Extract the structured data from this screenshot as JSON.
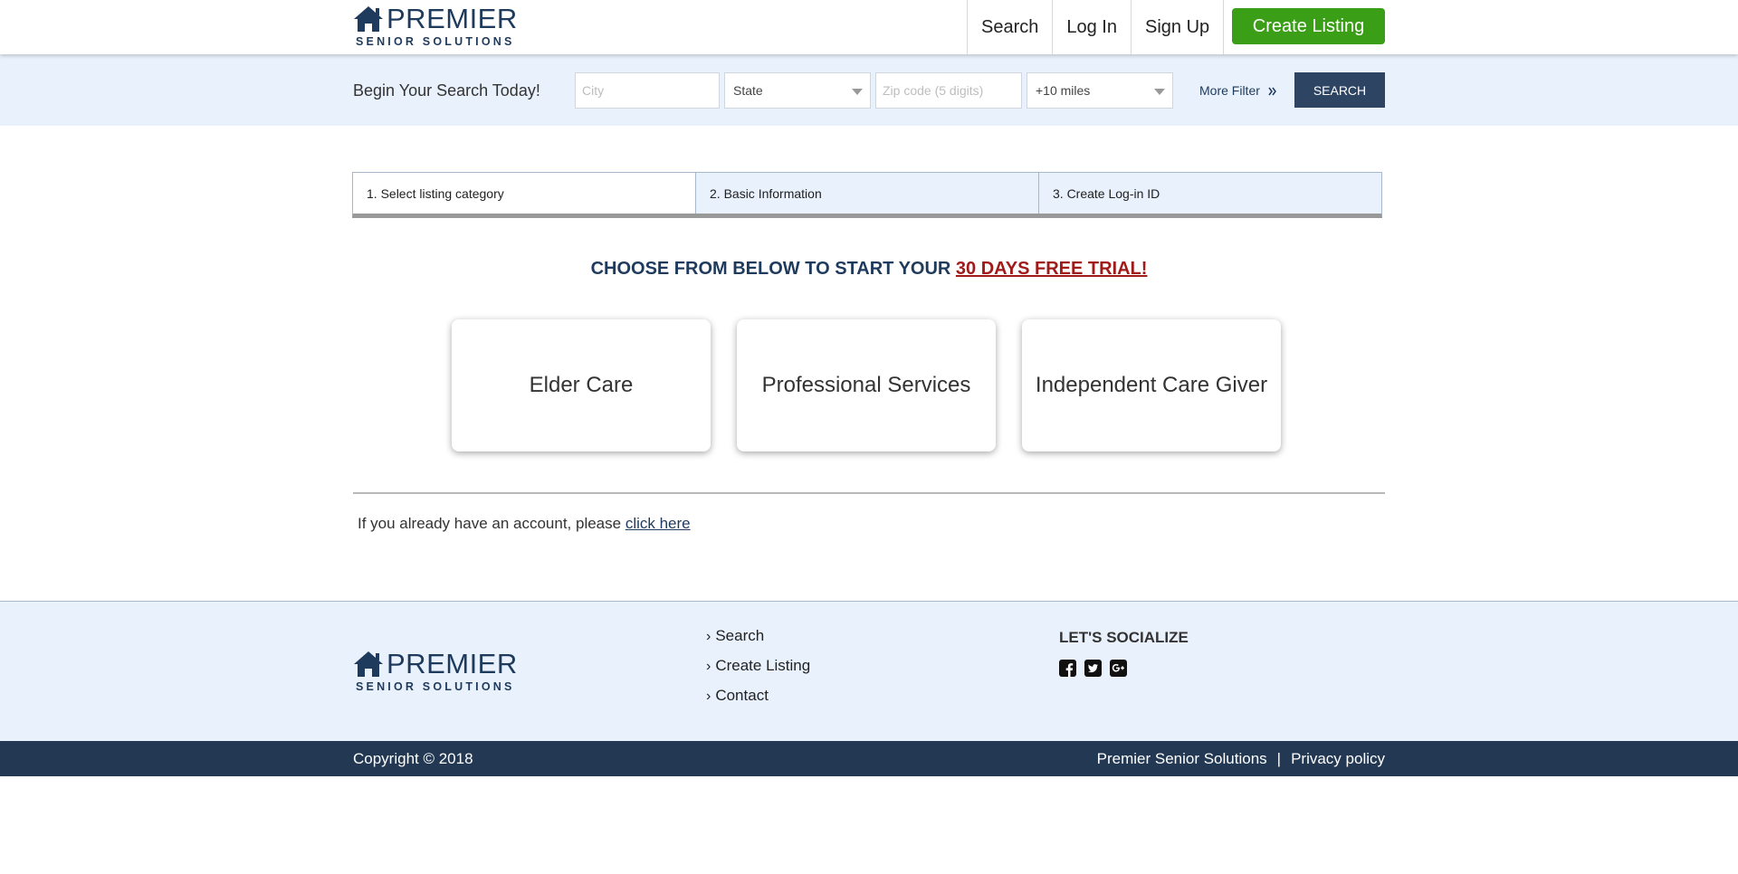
{
  "brand": {
    "name": "PREMIER",
    "tagline": "SENIOR SOLUTIONS"
  },
  "nav": {
    "search": "Search",
    "login": "Log In",
    "signup": "Sign Up",
    "create_listing": "Create Listing"
  },
  "searchbar": {
    "title": "Begin Your Search Today!",
    "city_placeholder": "City",
    "state_value": "State",
    "zip_placeholder": "Zip code (5 digits)",
    "radius_value": "+10 miles",
    "more_filter": "More Filter",
    "search_button": "SEARCH"
  },
  "steps": [
    {
      "label": "1. Select listing category"
    },
    {
      "label": "2. Basic Information"
    },
    {
      "label": "3. Create Log-in ID"
    }
  ],
  "headline": {
    "text": "CHOOSE FROM BELOW TO START YOUR ",
    "highlight": "30 DAYS FREE TRIAL!"
  },
  "categories": [
    {
      "label": "Elder Care"
    },
    {
      "label": "Professional Services"
    },
    {
      "label": "Independent Care Giver"
    }
  ],
  "account": {
    "text": "If you already have an account, please ",
    "link": "click here"
  },
  "footer": {
    "links": [
      {
        "label": "Search"
      },
      {
        "label": "Create Listing"
      },
      {
        "label": "Contact"
      }
    ],
    "social_title": "LET'S SOCIALIZE",
    "social_icons": [
      "facebook-icon",
      "twitter-icon",
      "google-plus-icon"
    ],
    "copyright": "Copyright © 2018",
    "company_link": "Premier Senior Solutions",
    "separator": "|",
    "privacy_link": "Privacy policy"
  },
  "colors": {
    "primary": "#1e3a5c",
    "accent_green": "#3a9e16",
    "highlight_red": "#a11a1a",
    "light_bg": "#e8f1fc",
    "dark_bar": "#223853"
  }
}
